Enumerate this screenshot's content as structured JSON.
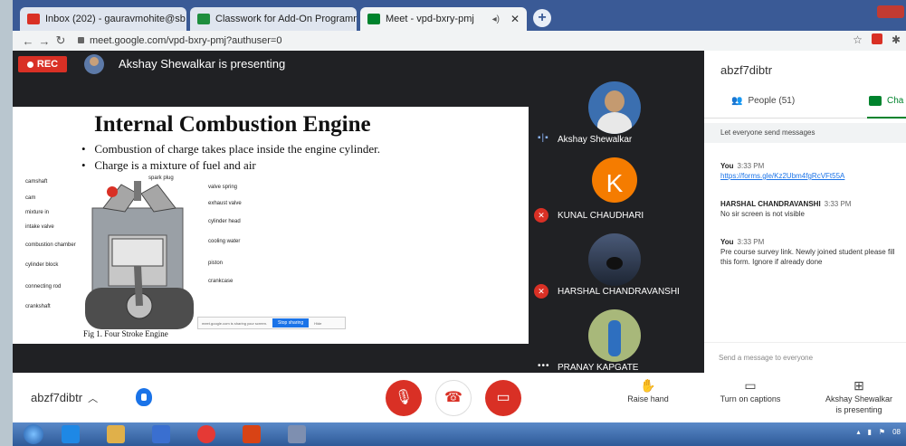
{
  "browser": {
    "tabs": [
      {
        "label": "Inbox (202) - gauravmohite@sb",
        "close": "✕"
      },
      {
        "label": "Classwork for Add-On Programm",
        "close": "✕"
      },
      {
        "label": "Meet - vpd-bxry-pmj",
        "close": "✕"
      }
    ],
    "new_tab": "+",
    "url": "meet.google.com/vpd-bxry-pmj?authuser=0"
  },
  "meet": {
    "rec_label": "REC",
    "presenting_banner": "Akshay Shewalkar is presenting",
    "slide": {
      "title": "Internal Combustion Engine",
      "bullets": [
        "Combustion of charge takes place inside the engine cylinder.",
        "Charge is a mixture of fuel and air"
      ],
      "labels_left": [
        "camshaft",
        "cam",
        "mixture in",
        "intake valve",
        "combustion chamber",
        "cylinder block",
        "connecting rod",
        "crankshaft"
      ],
      "labels_right": [
        "spark plug",
        "valve spring",
        "exhaust valve",
        "cylinder head",
        "cooling water",
        "piston",
        "crankcase"
      ],
      "figure_caption": "Fig 1. Four Stroke Engine",
      "share_text": "meet.google.com is sharing your screen.",
      "stop_sharing": "Stop sharing",
      "hide": "Hide"
    },
    "participants": [
      {
        "name": "Akshay Shewalkar",
        "initial": ""
      },
      {
        "name": "KUNAL CHAUDHARI",
        "initial": "K"
      },
      {
        "name": "HARSHAL CHANDRAVANSHI",
        "initial": ""
      },
      {
        "name": "PRANAY KAPGATE",
        "initial": ""
      }
    ]
  },
  "panel": {
    "meeting_code": "abzf7dibtr",
    "people_tab": "People (51)",
    "chat_tab": "Cha",
    "everyone_toggle": "Let everyone send messages",
    "messages": [
      {
        "sender": "You",
        "time": "3:33 PM",
        "text": "https://forms.gle/Kz2Ubm4fgRcVFt55A"
      },
      {
        "sender": "HARSHAL CHANDRAVANSHI",
        "time": "3:33 PM",
        "text": "No sir screen is not visible"
      },
      {
        "sender": "You",
        "time": "3:33 PM",
        "text": "Pre course survey link. Newly joined student please fill this form. Ignore if already done"
      }
    ],
    "send_placeholder": "Send a message to everyone"
  },
  "controls": {
    "meeting_code": "abzf7dibtr",
    "raise_hand": "Raise hand",
    "captions": "Turn on captions",
    "presenting_line1": "Akshay Shewalkar",
    "presenting_line2": "is presenting"
  },
  "taskbar": {
    "clock": "08"
  },
  "colors": {
    "meet_bg": "#202124",
    "red": "#d93025",
    "chat_green": "#00832d",
    "link_blue": "#1a73e8"
  }
}
